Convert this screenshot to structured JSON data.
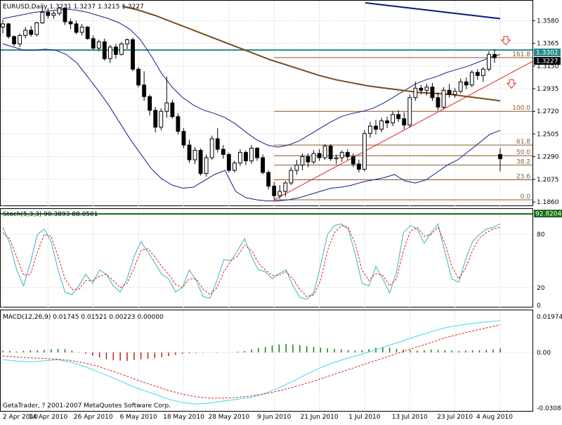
{
  "header": {
    "price_label": "EURUSD,Daily  1.3231 1.3237 1.3215 1.3227",
    "stoch_label": "Stoch(5,3,3) 90.3893 88.0501",
    "macd_label": "MACD(12,26,9) 0.01745 0.01521 0.00223 0.00000",
    "copyright": "GetaTrader, ? 2001-2007 MetaQuotes Software Corp."
  },
  "badges": {
    "price_level": "1.3302",
    "price_last": "1.3227",
    "stoch_level": "92.8204"
  },
  "x_axis": [
    "2 Apr 2010",
    "14 Apr 2010",
    "26 Apr 2010",
    "6 May 2010",
    "18 May 2010",
    "28 May 2010",
    "9 Jun 2010",
    "21 Jun 2010",
    "1 Jul 2010",
    "13 Jul 2010",
    "23 Jul 2010",
    "4 Aug 2010"
  ],
  "colors": {
    "candle_bull": "#ffffff",
    "candle_bear": "#000000",
    "bollinger": "#1a1a8c",
    "ma_long": "#7b4a1c",
    "ma_top": "#0a1a7a",
    "horizontal_level": "#2a8a8a",
    "fib": "#8b5a2b",
    "trendline": "#e02020",
    "stoch_main": "#3fb0c0",
    "stoch_signal": "#e02020",
    "macd_hist": "#1a7a1a",
    "macd_hist_neg": "#c02020",
    "macd_main": "#40d8f0",
    "macd_signal": "#e02020",
    "arrow": "#e02020"
  },
  "chart_data": [
    {
      "type": "candlestick",
      "title": "EURUSD,Daily",
      "ohlc_last": {
        "open": 1.3231,
        "high": 1.3237,
        "low": 1.3215,
        "close": 1.3227
      },
      "y_ticks": [
        "1.3580",
        "1.3365",
        "1.3150",
        "1.2935",
        "1.2720",
        "1.2505",
        "1.2290",
        "1.2075",
        "1.1860"
      ],
      "ylim": [
        1.184,
        1.375
      ],
      "candles": [
        [
          1.352,
          1.359,
          1.346,
          1.355
        ],
        [
          1.355,
          1.356,
          1.341,
          1.343
        ],
        [
          1.343,
          1.344,
          1.334,
          1.336
        ],
        [
          1.336,
          1.346,
          1.333,
          1.344
        ],
        [
          1.344,
          1.352,
          1.341,
          1.349
        ],
        [
          1.349,
          1.353,
          1.343,
          1.345
        ],
        [
          1.345,
          1.357,
          1.343,
          1.356
        ],
        [
          1.356,
          1.372,
          1.355,
          1.366
        ],
        [
          1.366,
          1.37,
          1.36,
          1.363
        ],
        [
          1.363,
          1.367,
          1.36,
          1.365
        ],
        [
          1.365,
          1.371,
          1.363,
          1.37
        ],
        [
          1.37,
          1.371,
          1.354,
          1.357
        ],
        [
          1.357,
          1.36,
          1.35,
          1.355
        ],
        [
          1.355,
          1.358,
          1.345,
          1.347
        ],
        [
          1.347,
          1.355,
          1.344,
          1.352
        ],
        [
          1.352,
          1.353,
          1.34,
          1.341
        ],
        [
          1.341,
          1.344,
          1.33,
          1.332
        ],
        [
          1.332,
          1.34,
          1.329,
          1.338
        ],
        [
          1.338,
          1.341,
          1.32,
          1.322
        ],
        [
          1.322,
          1.335,
          1.318,
          1.333
        ],
        [
          1.333,
          1.336,
          1.322,
          1.326
        ],
        [
          1.326,
          1.338,
          1.325,
          1.336
        ],
        [
          1.336,
          1.341,
          1.331,
          1.34
        ],
        [
          1.34,
          1.342,
          1.31,
          1.312
        ],
        [
          1.312,
          1.314,
          1.295,
          1.297
        ],
        [
          1.297,
          1.31,
          1.282,
          1.286
        ],
        [
          1.286,
          1.288,
          1.268,
          1.273
        ],
        [
          1.273,
          1.276,
          1.252,
          1.257
        ],
        [
          1.257,
          1.275,
          1.254,
          1.272
        ],
        [
          1.272,
          1.305,
          1.266,
          1.28
        ],
        [
          1.28,
          1.283,
          1.265,
          1.267
        ],
        [
          1.267,
          1.27,
          1.25,
          1.253
        ],
        [
          1.253,
          1.256,
          1.237,
          1.24
        ],
        [
          1.24,
          1.245,
          1.223,
          1.226
        ],
        [
          1.226,
          1.238,
          1.222,
          1.235
        ],
        [
          1.235,
          1.237,
          1.211,
          1.213
        ],
        [
          1.213,
          1.231,
          1.21,
          1.228
        ],
        [
          1.228,
          1.249,
          1.226,
          1.246
        ],
        [
          1.246,
          1.256,
          1.233,
          1.236
        ],
        [
          1.236,
          1.24,
          1.227,
          1.231
        ],
        [
          1.231,
          1.233,
          1.214,
          1.216
        ],
        [
          1.216,
          1.225,
          1.214,
          1.223
        ],
        [
          1.223,
          1.236,
          1.22,
          1.233
        ],
        [
          1.233,
          1.235,
          1.221,
          1.225
        ],
        [
          1.225,
          1.24,
          1.222,
          1.237
        ],
        [
          1.237,
          1.238,
          1.225,
          1.228
        ],
        [
          1.228,
          1.231,
          1.212,
          1.214
        ],
        [
          1.214,
          1.216,
          1.198,
          1.201
        ],
        [
          1.201,
          1.205,
          1.188,
          1.192
        ],
        [
          1.192,
          1.202,
          1.189,
          1.196
        ],
        [
          1.196,
          1.206,
          1.191,
          1.204
        ],
        [
          1.204,
          1.219,
          1.202,
          1.216
        ],
        [
          1.216,
          1.226,
          1.212,
          1.221
        ],
        [
          1.221,
          1.232,
          1.216,
          1.229
        ],
        [
          1.229,
          1.232,
          1.219,
          1.224
        ],
        [
          1.224,
          1.235,
          1.222,
          1.232
        ],
        [
          1.232,
          1.236,
          1.225,
          1.228
        ],
        [
          1.228,
          1.241,
          1.226,
          1.239
        ],
        [
          1.239,
          1.241,
          1.225,
          1.227
        ],
        [
          1.227,
          1.231,
          1.222,
          1.228
        ],
        [
          1.228,
          1.235,
          1.224,
          1.233
        ],
        [
          1.233,
          1.236,
          1.226,
          1.229
        ],
        [
          1.229,
          1.232,
          1.219,
          1.222
        ],
        [
          1.222,
          1.226,
          1.214,
          1.217
        ],
        [
          1.217,
          1.254,
          1.215,
          1.251
        ],
        [
          1.251,
          1.262,
          1.247,
          1.258
        ],
        [
          1.258,
          1.264,
          1.25,
          1.255
        ],
        [
          1.255,
          1.266,
          1.252,
          1.263
        ],
        [
          1.263,
          1.267,
          1.256,
          1.261
        ],
        [
          1.261,
          1.272,
          1.258,
          1.269
        ],
        [
          1.269,
          1.273,
          1.262,
          1.265
        ],
        [
          1.265,
          1.271,
          1.255,
          1.259
        ],
        [
          1.259,
          1.288,
          1.257,
          1.285
        ],
        [
          1.285,
          1.3,
          1.282,
          1.294
        ],
        [
          1.294,
          1.297,
          1.288,
          1.292
        ],
        [
          1.292,
          1.298,
          1.287,
          1.295
        ],
        [
          1.295,
          1.299,
          1.282,
          1.285
        ],
        [
          1.285,
          1.29,
          1.273,
          1.276
        ],
        [
          1.276,
          1.295,
          1.274,
          1.292
        ],
        [
          1.292,
          1.298,
          1.285,
          1.288
        ],
        [
          1.288,
          1.294,
          1.285,
          1.291
        ],
        [
          1.291,
          1.303,
          1.289,
          1.3
        ],
        [
          1.3,
          1.304,
          1.293,
          1.297
        ],
        [
          1.297,
          1.311,
          1.295,
          1.309
        ],
        [
          1.309,
          1.312,
          1.302,
          1.306
        ],
        [
          1.306,
          1.314,
          1.3,
          1.312
        ],
        [
          1.312,
          1.329,
          1.31,
          1.326
        ],
        [
          1.326,
          1.331,
          1.318,
          1.323
        ],
        [
          1.231,
          1.237,
          1.215,
          1.227
        ]
      ],
      "bollinger": {
        "upper": [
          1.36,
          1.362,
          1.364,
          1.366,
          1.367,
          1.368,
          1.369,
          1.368,
          1.366,
          1.363,
          1.36,
          1.356,
          1.35,
          1.34,
          1.325,
          1.308,
          1.295,
          1.285,
          1.278,
          1.273,
          1.27,
          1.266,
          1.26,
          1.252,
          1.245,
          1.24,
          1.238,
          1.24,
          1.244,
          1.25,
          1.256,
          1.262,
          1.267,
          1.27,
          1.272,
          1.275,
          1.28,
          1.286,
          1.292,
          1.298,
          1.302,
          1.305,
          1.309,
          1.312,
          1.315,
          1.319,
          1.323,
          1.326
        ],
        "lower": [
          1.336,
          1.333,
          1.33,
          1.33,
          1.331,
          1.33,
          1.326,
          1.318,
          1.305,
          1.292,
          1.278,
          1.262,
          1.246,
          1.232,
          1.218,
          1.208,
          1.202,
          1.199,
          1.2,
          1.206,
          1.212,
          1.216,
          1.196,
          1.19,
          1.188,
          1.187,
          1.187,
          1.188,
          1.19,
          1.193,
          1.196,
          1.199,
          1.2,
          1.202,
          1.205,
          1.207,
          1.209,
          1.212,
          1.206,
          1.204,
          1.207,
          1.214,
          1.221,
          1.226,
          1.234,
          1.242,
          1.25,
          1.254
        ]
      },
      "ma_long": [
        1.372,
        1.368,
        1.363,
        1.357,
        1.351,
        1.345,
        1.339,
        1.333,
        1.327,
        1.321,
        1.316,
        1.311,
        1.306,
        1.302,
        1.299,
        1.296,
        1.294,
        1.292,
        1.29,
        1.289,
        1.288,
        1.286,
        1.284,
        1.282
      ],
      "ma_top": [
        1.375,
        1.372,
        1.369,
        1.366,
        1.363,
        1.36
      ],
      "levels": [
        1.3302
      ],
      "fib_levels": [
        {
          "label": "161.8",
          "value": 1.323
        },
        {
          "label": "100.0",
          "value": 1.272
        },
        {
          "label": "61.8",
          "value": 1.24
        },
        {
          "label": "50.0",
          "value": 1.23
        },
        {
          "label": "38.2",
          "value": 1.221
        },
        {
          "label": "23.6",
          "value": 1.207
        },
        {
          "label": "0.0",
          "value": 1.188
        }
      ],
      "trendline": {
        "from": [
          48,
          1.188
        ],
        "to": [
          88,
          1.303
        ]
      },
      "arrows_down": [
        {
          "index": 89,
          "value": 1.339
        },
        {
          "index": 90,
          "value": 1.298
        }
      ]
    },
    {
      "type": "line",
      "title": "Stoch(5,3,3)",
      "y_ticks": [
        "80",
        "20",
        "0"
      ],
      "ylim": [
        0,
        100
      ],
      "series": [
        {
          "name": "main",
          "values": [
            88,
            70,
            40,
            22,
            48,
            80,
            86,
            72,
            40,
            15,
            12,
            22,
            35,
            25,
            40,
            35,
            22,
            15,
            30,
            55,
            72,
            60,
            48,
            35,
            30,
            15,
            20,
            40,
            28,
            10,
            8,
            28,
            52,
            50,
            62,
            75,
            55,
            40,
            38,
            30,
            36,
            40,
            22,
            9,
            7,
            14,
            45,
            80,
            90,
            92,
            86,
            58,
            25,
            22,
            44,
            30,
            14,
            38,
            82,
            90,
            86,
            70,
            82,
            92,
            60,
            30,
            26,
            52,
            72,
            80,
            86,
            88,
            92
          ]
        },
        {
          "name": "signal",
          "values": [
            82,
            75,
            55,
            34,
            35,
            60,
            80,
            78,
            55,
            30,
            18,
            18,
            28,
            28,
            33,
            35,
            28,
            20,
            25,
            42,
            62,
            64,
            55,
            44,
            35,
            24,
            20,
            30,
            30,
            18,
            12,
            20,
            38,
            50,
            56,
            68,
            62,
            48,
            40,
            34,
            34,
            38,
            30,
            18,
            10,
            12,
            28,
            62,
            82,
            90,
            88,
            70,
            40,
            28,
            36,
            34,
            22,
            30,
            62,
            84,
            88,
            78,
            80,
            88,
            70,
            44,
            30,
            42,
            62,
            76,
            82,
            86,
            88
          ]
        }
      ]
    },
    {
      "type": "bar+line",
      "title": "MACD(12,26,9)",
      "y_ticks": [
        "0.01974",
        "0.00",
        "-0.03081"
      ],
      "ylim": [
        -0.0315,
        0.0205
      ],
      "histogram": [
        0.001,
        0.0008,
        0.0005,
        0.0009,
        0.0012,
        0.0011,
        0.0014,
        0.0017,
        0.002,
        0.0018,
        0.001,
        0.0002,
        -0.0008,
        -0.0018,
        -0.0028,
        -0.0038,
        -0.0043,
        -0.0045,
        -0.0047,
        -0.0042,
        -0.0038,
        -0.0035,
        -0.0032,
        -0.0026,
        -0.002,
        -0.0014,
        -0.0008,
        -0.0005,
        -0.0003,
        -0.0002,
        -0.0001,
        -0.0002,
        -0.0001,
        0.0,
        0.0004,
        0.0008,
        0.0016,
        0.0024,
        0.003,
        0.0038,
        0.0044,
        0.0046,
        0.0044,
        0.004,
        0.0034,
        0.003,
        0.0026,
        0.0022,
        0.0019,
        0.0017,
        0.0013,
        0.001,
        0.0013,
        0.0018,
        0.0026,
        0.003,
        0.0026,
        0.002,
        0.0016,
        0.0013,
        0.001,
        0.0012,
        0.0016,
        0.0014,
        0.0012,
        0.001,
        0.0008,
        0.001,
        0.0011,
        0.0012,
        0.0014,
        0.0016,
        0.0022
      ],
      "series": [
        {
          "name": "main",
          "values": [
            -0.004,
            -0.0048,
            -0.0052,
            -0.0046,
            -0.004,
            -0.0055,
            -0.008,
            -0.011,
            -0.014,
            -0.0175,
            -0.0205,
            -0.023,
            -0.0258,
            -0.0276,
            -0.0285,
            -0.028,
            -0.0268,
            -0.0258,
            -0.0248,
            -0.0225,
            -0.0195,
            -0.016,
            -0.012,
            -0.0085,
            -0.0055,
            -0.003,
            -0.001,
            0.0015,
            0.004,
            0.0065,
            0.009,
            0.0115,
            0.0135,
            0.015,
            0.016,
            0.0168,
            0.0175
          ]
        },
        {
          "name": "signal",
          "values": [
            -0.002,
            -0.0025,
            -0.003,
            -0.0034,
            -0.0038,
            -0.0045,
            -0.006,
            -0.008,
            -0.0105,
            -0.0132,
            -0.016,
            -0.0185,
            -0.021,
            -0.023,
            -0.0245,
            -0.0252,
            -0.0252,
            -0.0248,
            -0.024,
            -0.0228,
            -0.0212,
            -0.0192,
            -0.017,
            -0.0146,
            -0.012,
            -0.0095,
            -0.007,
            -0.0045,
            -0.002,
            0.0005,
            0.003,
            0.0055,
            0.008,
            0.01,
            0.0118,
            0.0135,
            0.0152
          ]
        }
      ]
    }
  ]
}
